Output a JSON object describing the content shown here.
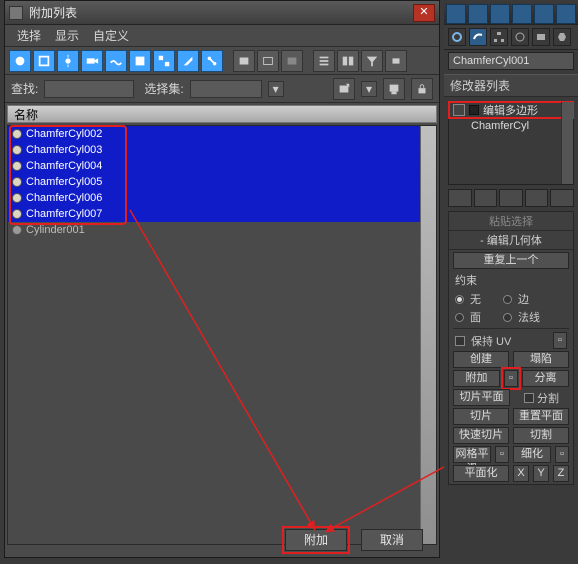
{
  "dialog": {
    "title": "附加列表",
    "menus": [
      "选择",
      "显示",
      "自定义"
    ],
    "search_label": "查找:",
    "search_value": "",
    "selset_label": "选择集:",
    "selset_value": "",
    "list_header": "名称",
    "items": [
      {
        "label": "ChamferCyl002",
        "selected": true
      },
      {
        "label": "ChamferCyl003",
        "selected": true
      },
      {
        "label": "ChamferCyl004",
        "selected": true
      },
      {
        "label": "ChamferCyl005",
        "selected": true
      },
      {
        "label": "ChamferCyl006",
        "selected": true
      },
      {
        "label": "ChamferCyl007",
        "selected": true
      },
      {
        "label": "Cylinder001",
        "selected": false
      }
    ],
    "ok_label": "附加",
    "cancel_label": "取消"
  },
  "right": {
    "object_name": "ChamferCyl001",
    "mod_list_label": "修改器列表",
    "mod_stack": [
      {
        "label": "编辑多边形",
        "highlight": true
      },
      {
        "label": "ChamferCyl",
        "highlight": false
      }
    ],
    "rollups": {
      "edit_geo": {
        "title_hint": "粘贴选择",
        "label": "编辑几何体",
        "repeat": "重复上一个",
        "constraint_title": "约束",
        "opt_none": "无",
        "opt_edge": "边",
        "opt_face": "面",
        "opt_normal": "法线",
        "preserve_uv": "保持 UV",
        "create": "创建",
        "collapse": "塌陷",
        "attach": "附加",
        "detach": "分离",
        "slice_plane": "切片平面",
        "split_cb": "分割",
        "slice": "切片",
        "reset_plane": "重置平面",
        "quick_slice": "快速切片",
        "cut": "切割",
        "msmooth": "网格平滑",
        "tess": "细化",
        "planarize": "平面化"
      }
    }
  }
}
